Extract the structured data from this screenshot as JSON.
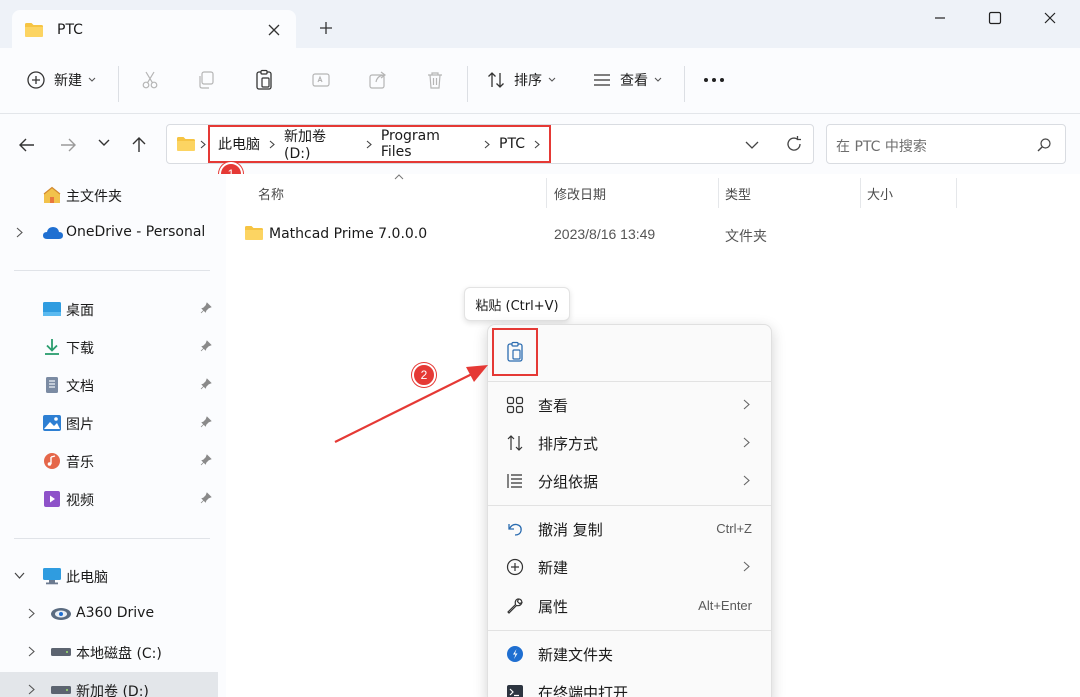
{
  "window": {
    "tab_title": "PTC",
    "add_tab": "+"
  },
  "toolbar": {
    "new_label": "新建",
    "sort_label": "排序",
    "view_label": "查看",
    "more_label": "···"
  },
  "address": {
    "crumbs": [
      "此电脑",
      "新加卷 (D:)",
      "Program Files",
      "PTC"
    ],
    "search_placeholder": "在 PTC 中搜索"
  },
  "annotations": {
    "step1": "1",
    "step2": "2",
    "highlight_color": "#e53935"
  },
  "sidebar": {
    "items": [
      {
        "label": "主文件夹",
        "icon": "home-icon"
      },
      {
        "label": "OneDrive - Personal",
        "icon": "cloud-icon"
      },
      {
        "label": "桌面",
        "icon": "desktop-icon"
      },
      {
        "label": "下载",
        "icon": "download-icon"
      },
      {
        "label": "文档",
        "icon": "document-icon"
      },
      {
        "label": "图片",
        "icon": "picture-icon"
      },
      {
        "label": "音乐",
        "icon": "music-icon"
      },
      {
        "label": "视频",
        "icon": "video-icon"
      },
      {
        "label": "此电脑",
        "icon": "computer-icon"
      },
      {
        "label": "A360 Drive",
        "icon": "a360-icon"
      },
      {
        "label": "本地磁盘 (C:)",
        "icon": "drive-icon"
      },
      {
        "label": "新加卷 (D:)",
        "icon": "drive-icon"
      }
    ]
  },
  "columns": {
    "name": "名称",
    "modified": "修改日期",
    "type": "类型",
    "size": "大小"
  },
  "files": [
    {
      "name": "Mathcad Prime 7.0.0.0",
      "modified": "2023/8/16 13:49",
      "type": "文件夹",
      "size": ""
    }
  ],
  "tooltip": {
    "text": "粘贴 (Ctrl+V)"
  },
  "context_menu": {
    "items": [
      {
        "label": "查看",
        "shortcut": "",
        "icon": "grid-view-icon"
      },
      {
        "label": "排序方式",
        "shortcut": "",
        "icon": "sort-icon"
      },
      {
        "label": "分组依据",
        "shortcut": "",
        "icon": "group-icon"
      },
      {
        "label": "撤消 复制",
        "shortcut": "Ctrl+Z",
        "icon": "undo-icon"
      },
      {
        "label": "新建",
        "shortcut": "",
        "icon": "new-icon"
      },
      {
        "label": "属性",
        "shortcut": "Alt+Enter",
        "icon": "wrench-icon"
      },
      {
        "label": "新建文件夹",
        "shortcut": "",
        "icon": "new-folder-icon"
      },
      {
        "label": "在终端中打开",
        "shortcut": "",
        "icon": "terminal-icon"
      }
    ]
  }
}
